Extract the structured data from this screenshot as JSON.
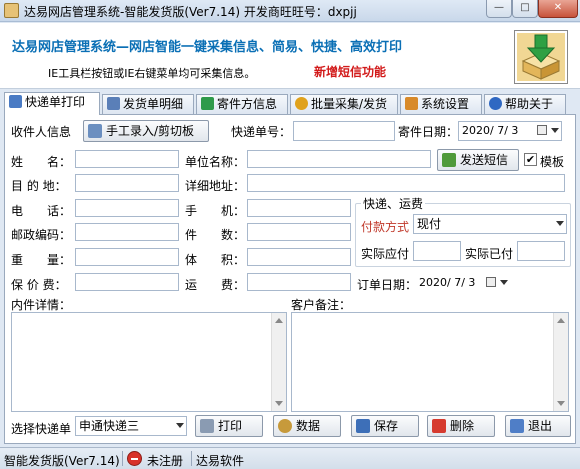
{
  "window": {
    "title": "达易网店管理系统-智能发货版(Ver7.14) 开发商旺旺号：dxpjj",
    "min_label": "—",
    "max_label": "□",
    "close_label": "✕"
  },
  "banner": {
    "slogan": "达易网店管理系统—网店智能一键采集信息、简易、快捷、高效打印",
    "tip": "IE工具栏按钮或IE右键菜单均可采集信息。",
    "new_feature": "新增短信功能"
  },
  "tabs": [
    {
      "label": "快递单打印",
      "icon": "printer-icon",
      "color": "#4a7bc4"
    },
    {
      "label": "发货单明细",
      "icon": "document-icon",
      "color": "#5a7fb8"
    },
    {
      "label": "寄件方信息",
      "icon": "card-icon",
      "color": "#2e9a4a"
    },
    {
      "label": "批量采集/发货",
      "icon": "batch-icon",
      "color": "#e0a21c"
    },
    {
      "label": "系统设置",
      "icon": "settings-icon",
      "color": "#d88a2a"
    },
    {
      "label": "帮助关于",
      "icon": "help-icon",
      "color": "#2f68c2"
    }
  ],
  "form": {
    "recipient_info": "收件人信息",
    "manual_button": "手工录入/剪切板",
    "tracking_label": "快递单号：",
    "tracking_value": "",
    "send_date_label": "寄件日期：",
    "send_date": "2020/ 7/ 3",
    "name_label": "姓　　名：",
    "company_label": "单位名称：",
    "send_sms": "发送短信",
    "template_label": "模板",
    "template_checked": true,
    "destination_label": "目 的 地：",
    "address_label": "详细地址：",
    "phone_label": "电　　话：",
    "mobile_label": "手　　机：",
    "postcode_label": "邮政编码：",
    "pieces_label": "件　　数：",
    "weight_label": "重　　量：",
    "volume_label": "体　　积：",
    "insured_label": "保 价 费：",
    "freight_label": "运　　费：",
    "shipping_group": "快递、运费",
    "payment_label": "付款方式",
    "payment_value": "现付",
    "payable_label": "实际应付",
    "paid_label": "实际已付",
    "order_date_label": "订单日期：",
    "order_date": "2020/ 7/ 3",
    "contents_label": "内件详情：",
    "remarks_label": "客户备注："
  },
  "bottom": {
    "select_courier_label": "选择快递单",
    "courier_value": "申通快递三",
    "print": "打印",
    "data": "数据",
    "save": "保存",
    "delete": "删除",
    "exit": "退出"
  },
  "status": {
    "version": "智能发货版(Ver7.14)",
    "registration": "未注册",
    "vendor": "达易软件"
  }
}
